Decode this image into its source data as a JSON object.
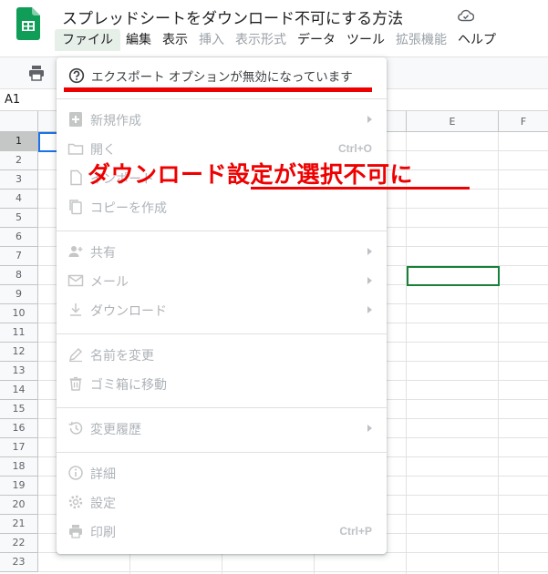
{
  "doc_title": "スプレッドシートをダウンロード不可にする方法",
  "menubar": [
    {
      "label": "ファイル",
      "state": "active"
    },
    {
      "label": "編集",
      "state": "normal"
    },
    {
      "label": "表示",
      "state": "normal"
    },
    {
      "label": "挿入",
      "state": "disabled"
    },
    {
      "label": "表示形式",
      "state": "disabled"
    },
    {
      "label": "データ",
      "state": "normal"
    },
    {
      "label": "ツール",
      "state": "normal"
    },
    {
      "label": "拡張機能",
      "state": "disabled"
    },
    {
      "label": "ヘルプ",
      "state": "normal"
    }
  ],
  "name_box": "A1",
  "columns": [
    "",
    "",
    "",
    "",
    "E",
    "F"
  ],
  "rows": [
    "1",
    "2",
    "3",
    "4",
    "5",
    "6",
    "7",
    "8",
    "9",
    "10",
    "11",
    "12",
    "13",
    "14",
    "15",
    "16",
    "17",
    "18",
    "19",
    "20",
    "21",
    "22",
    "23"
  ],
  "file_menu": {
    "export_notice": "エクスポート オプションが無効になっています",
    "items": [
      {
        "label": "新規作成",
        "shortcut": "",
        "submenu": true,
        "icon": "new-doc-icon"
      },
      {
        "label": "開く",
        "shortcut": "Ctrl+O",
        "submenu": false,
        "icon": "folder-icon"
      },
      {
        "label": "インポート",
        "shortcut": "",
        "submenu": false,
        "icon": "import-icon"
      },
      {
        "label": "コピーを作成",
        "shortcut": "",
        "submenu": false,
        "icon": "copy-icon"
      },
      {
        "label": "共有",
        "shortcut": "",
        "submenu": true,
        "icon": "share-person-icon"
      },
      {
        "label": "メール",
        "shortcut": "",
        "submenu": true,
        "icon": "mail-icon"
      },
      {
        "label": "ダウンロード",
        "shortcut": "",
        "submenu": true,
        "icon": "download-icon"
      },
      {
        "label": "名前を変更",
        "shortcut": "",
        "submenu": false,
        "icon": "rename-icon"
      },
      {
        "label": "ゴミ箱に移動",
        "shortcut": "",
        "submenu": false,
        "icon": "trash-icon"
      },
      {
        "label": "変更履歴",
        "shortcut": "",
        "submenu": true,
        "icon": "history-icon"
      },
      {
        "label": "詳細",
        "shortcut": "",
        "submenu": false,
        "icon": "info-icon"
      },
      {
        "label": "設定",
        "shortcut": "",
        "submenu": false,
        "icon": "gear-icon"
      },
      {
        "label": "印刷",
        "shortcut": "Ctrl+P",
        "submenu": false,
        "icon": "print-icon"
      }
    ]
  },
  "annotation": "ダウンロード設定が選択不可に",
  "colors": {
    "accent_red": "#ee0000",
    "sheets_green": "#0f9d58",
    "selection_blue": "#1a73e8",
    "selection_green": "#188038"
  }
}
